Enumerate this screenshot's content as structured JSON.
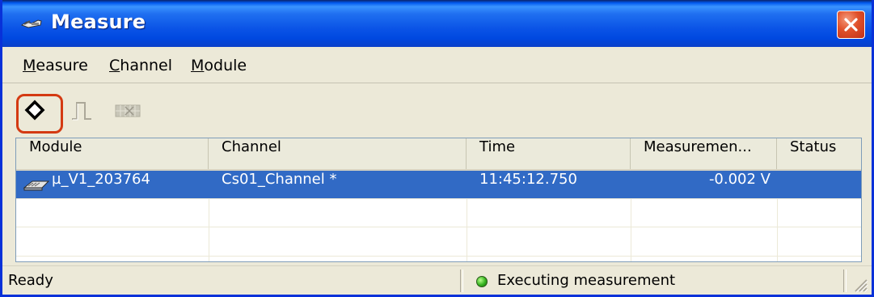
{
  "window": {
    "title": "Measure",
    "title_icon": "meter-icon",
    "close_icon": "close-icon"
  },
  "menu": {
    "items": [
      {
        "first": "M",
        "rest": "easure"
      },
      {
        "first": "C",
        "rest": "hannel"
      },
      {
        "first": "M",
        "rest": "odule"
      }
    ]
  },
  "toolbar": {
    "buttons": [
      {
        "icon": "diamond-icon",
        "state": "highlighted"
      },
      {
        "icon": "pulse-icon",
        "state": "disabled"
      },
      {
        "icon": "grid-icon",
        "state": "disabled"
      }
    ]
  },
  "table": {
    "columns": [
      "Module",
      "Channel",
      "Time",
      "Measuremen...",
      "Status"
    ],
    "rows": [
      {
        "module": "µ_V1_203764",
        "module_icon": "module-icon",
        "channel": "Cs01_Channel  *",
        "time": "11:45:12.750",
        "measurement": "-0.002 V",
        "status": ""
      }
    ]
  },
  "status": {
    "left": "Ready",
    "right": "Executing measurement",
    "indicator_color": "#34b21f"
  },
  "colors": {
    "selection": "#316ac5",
    "highlight_ring": "#d43a12",
    "titlebar": "#0058ee"
  }
}
